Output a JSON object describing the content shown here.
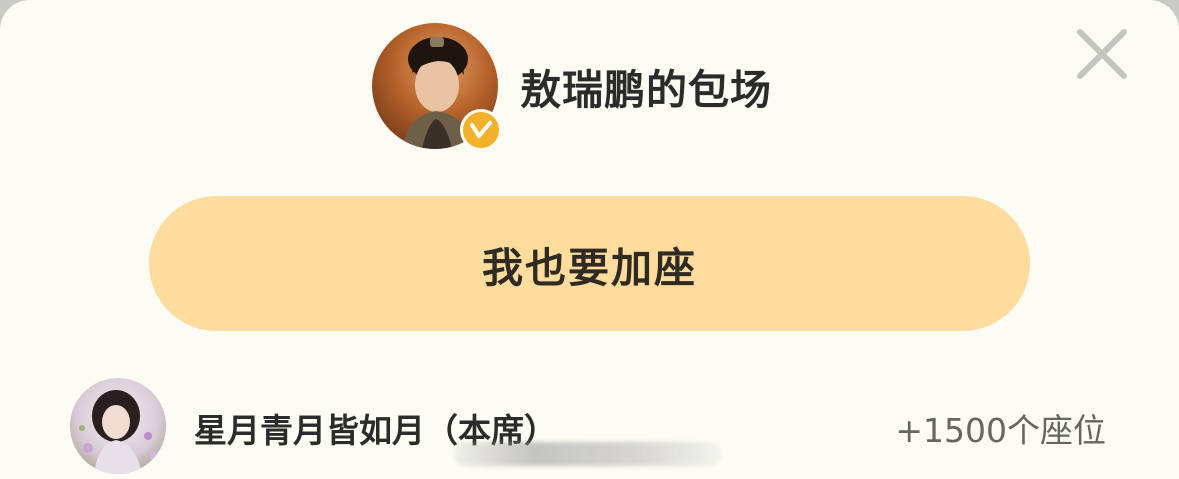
{
  "header": {
    "title": "敖瑞鹏的包场",
    "avatar_icon": "host-avatar-portrait",
    "badge_icon": "verified-v-icon",
    "badge_color": "#f2b12b"
  },
  "close": {
    "icon": "close-icon",
    "color": "#c4c4c0"
  },
  "join_button": {
    "label": "我也要加座",
    "color": "#fddc9d"
  },
  "supporters": [
    {
      "name": "星月青月皆如月（本席）",
      "seats": "+1500个座位"
    }
  ]
}
